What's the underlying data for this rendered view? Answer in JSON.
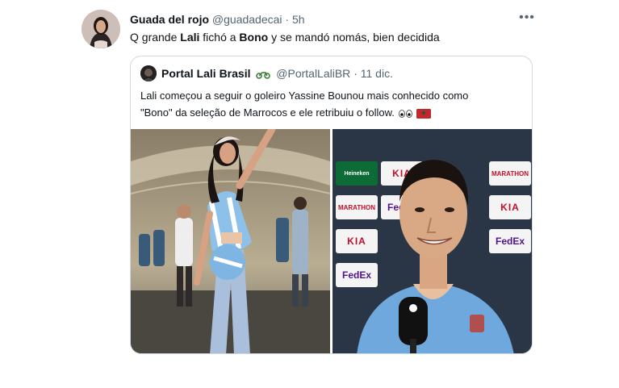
{
  "tweet": {
    "author_name": "Guada del rojo",
    "handle": "@guadadecai",
    "dot": "·",
    "time": "5h",
    "more_icon": "more-icon",
    "text_prefix": "Q grande ",
    "text_bold1": "Lali",
    "text_mid": " fichó a ",
    "text_bold2": "Bono",
    "text_suffix": " y se mandó nomás, bien decidida"
  },
  "quote": {
    "author_name": "Portal Lali Brasil",
    "emoji": "motorcycle-emoji",
    "handle": "@PortalLaliBR",
    "dot": "·",
    "time": "11 dic.",
    "text_line1": "Lali começou a seguir o goleiro Yassine Bounou mais conhecido como",
    "text_line2": "\"Bono\" da seleção de Marrocos e ele retribuiu o follow. ",
    "text_emojis": "eyes-emoji morocco-flag",
    "media": {
      "left_image": "woman-in-argentina-jersey-photo",
      "right_image": "goalkeeper-interview-photo",
      "sponsors": [
        "Heineken",
        "KIA",
        "MARATHON",
        "FedEx",
        "KIA",
        "MARATHON",
        "FedEx",
        "KIA",
        "FedEx"
      ]
    }
  }
}
